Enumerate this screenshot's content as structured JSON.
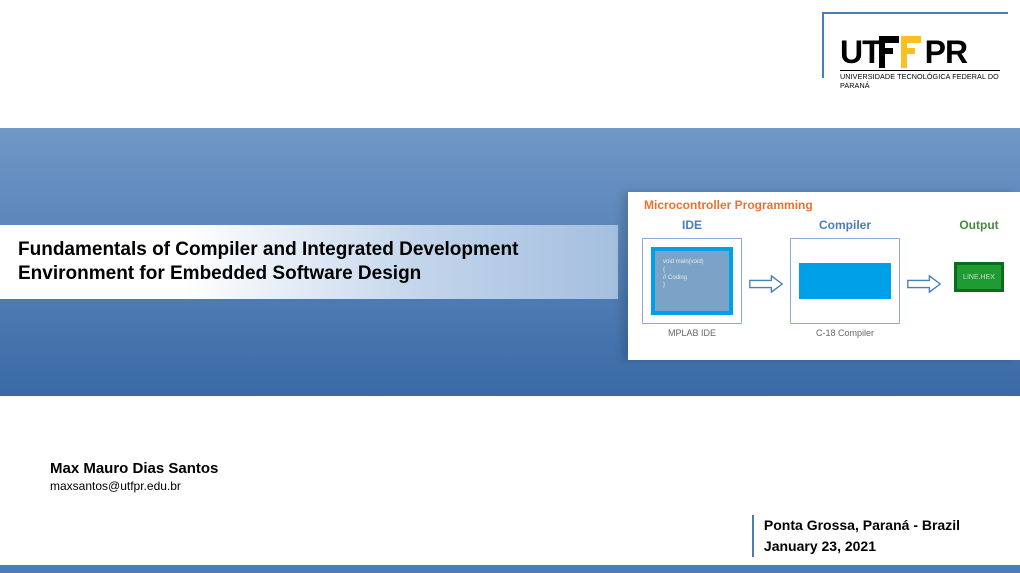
{
  "logo": {
    "text": "UTFPR",
    "subtitle": "UNIVERSIDADE TECNOLÓGICA FEDERAL DO PARANÁ"
  },
  "title": {
    "line1": "Fundamentals of Compiler and Integrated Development",
    "line2": "Environment for Embedded Software Design"
  },
  "diagram": {
    "heading": "Microcontroller Programming",
    "ide": {
      "label": "IDE",
      "sub": "MPLAB IDE",
      "code1": "void main(void)",
      "code2": "{",
      "code3": "// Coding",
      "code4": "}"
    },
    "compiler": {
      "label": "Compiler",
      "sub": "C-18 Compiler"
    },
    "output": {
      "label": "Output",
      "file": "LINE.HEX"
    }
  },
  "author": {
    "name": "Max Mauro Dias Santos",
    "email": "maxsantos@utfpr.edu.br"
  },
  "footer": {
    "location": "Ponta Grossa, Paraná - Brazil",
    "date": "January 23, 2021"
  }
}
